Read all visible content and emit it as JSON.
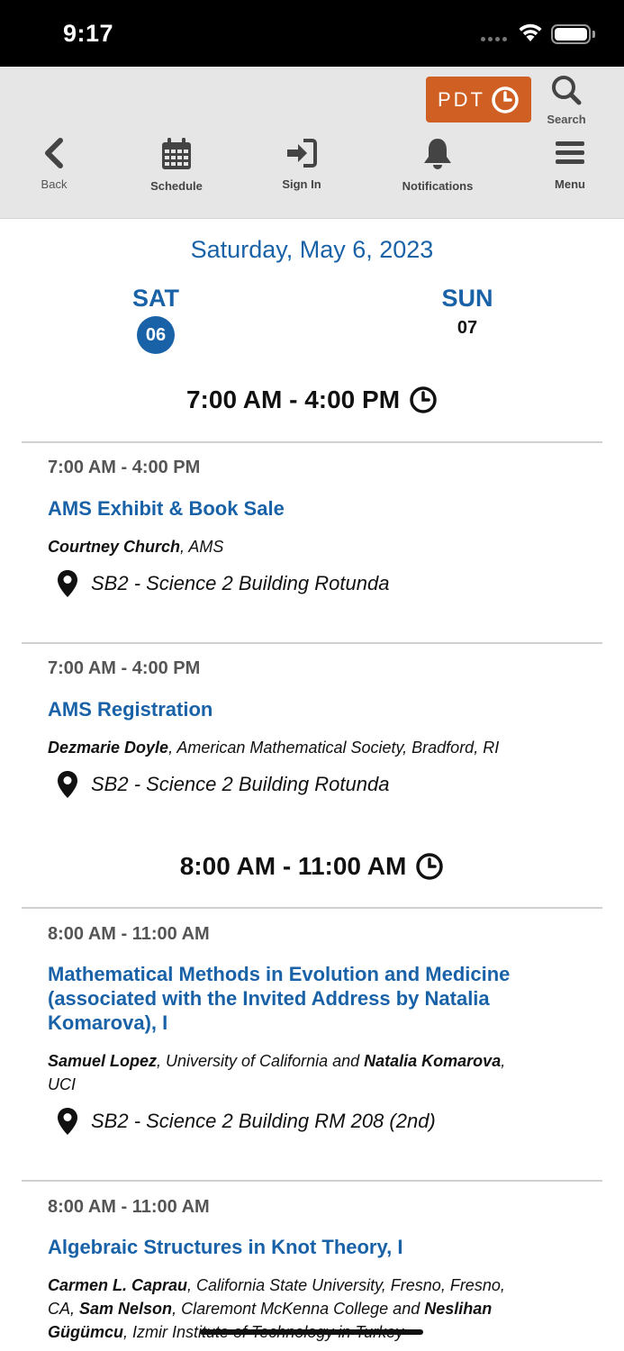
{
  "status_bar": {
    "time": "9:17"
  },
  "toolbar": {
    "timezone_label": "PDT",
    "search_label": "Search",
    "back_label": "Back",
    "schedule_label": "Schedule",
    "signin_label": "Sign In",
    "notifications_label": "Notifications",
    "menu_label": "Menu"
  },
  "date_header": "Saturday, May 6, 2023",
  "day_tabs": [
    {
      "dow": "SAT",
      "num": "06",
      "active": true
    },
    {
      "dow": "SUN",
      "num": "07",
      "active": false
    }
  ],
  "blocks": [
    {
      "heading": "7:00 AM - 4:00 PM",
      "sessions": [
        {
          "time": "7:00 AM - 4:00 PM",
          "title": "AMS Exhibit & Book Sale",
          "people_lines": [
            {
              "name": "Courtney Church",
              "affil": ", AMS"
            }
          ],
          "location": "SB2 - Science 2 Building Rotunda"
        },
        {
          "time": "7:00 AM - 4:00 PM",
          "title": "AMS Registration",
          "people_lines": [
            {
              "name": "Dezmarie Doyle",
              "affil": ", American Mathematical Society, Bradford, RI"
            }
          ],
          "location": "SB2 - Science 2 Building Rotunda"
        }
      ]
    },
    {
      "heading": "8:00 AM - 11:00 AM",
      "sessions": [
        {
          "time": "8:00 AM - 11:00 AM",
          "title_lines": [
            "Mathematical Methods in Evolution and Medicine",
            "(associated with the Invited Address by Natalia",
            "Komarova), I"
          ],
          "people": {
            "name1": "Samuel Lopez",
            "affil1": ", University of California and ",
            "name2": "Natalia Komarova",
            "affil2": ",",
            "line2": "UCI"
          },
          "location": "SB2 - Science 2 Building RM 208 (2nd)"
        },
        {
          "time": "8:00 AM - 11:00 AM",
          "title": "Algebraic Structures in Knot Theory, I",
          "people": {
            "name1": "Carmen L. Caprau",
            "affil1": ", California State University, Fresno, Fresno,",
            "line2_pre": "CA, ",
            "name2": "Sam Nelson",
            "affil2": ", Claremont McKenna College and ",
            "name3": "Neslihan",
            "name3b": "Gügümcu",
            "affil3": ", Izmir Institute of Technology in Turkey"
          }
        }
      ]
    }
  ],
  "colors": {
    "accent": "#1a62a8",
    "timezone_button": "#cf5f22",
    "toolbar_bg": "#e6e6e6"
  },
  "icons": [
    "wifi-icon",
    "battery-icon",
    "clock-icon",
    "search-icon",
    "chevron-left-icon",
    "calendar-icon",
    "sign-in-icon",
    "bell-icon",
    "hamburger-menu-icon",
    "map-pin-icon"
  ]
}
